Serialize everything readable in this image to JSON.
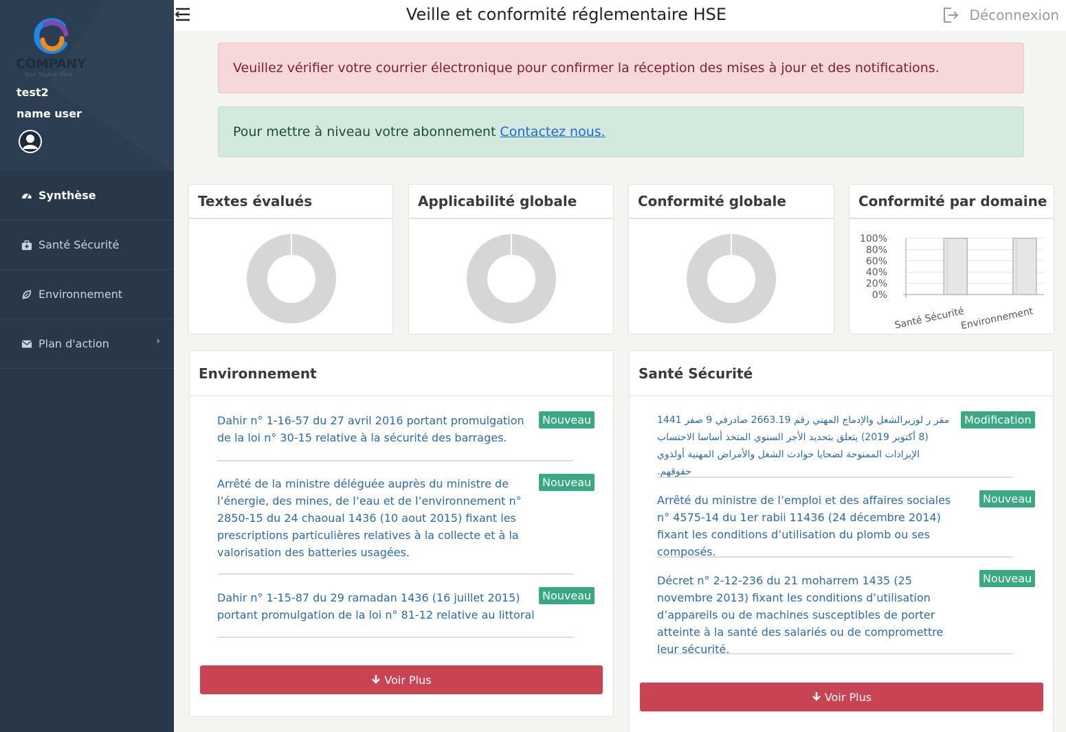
{
  "brand": {
    "name": "COMPANY",
    "tagline": "Your Tagline Here"
  },
  "user": {
    "org": "test2",
    "name": "name user"
  },
  "nav": [
    {
      "label": "Synthèse",
      "icon": "dashboard-icon",
      "active": true
    },
    {
      "label": "Santé Sécurité",
      "icon": "first-aid-icon",
      "active": false
    },
    {
      "label": "Environnement",
      "icon": "leaf-icon",
      "active": false
    },
    {
      "label": "Plan d'action",
      "icon": "envelope-icon",
      "active": false,
      "chevron": "›"
    }
  ],
  "header": {
    "title": "Veille et conformité réglementaire HSE",
    "logout": "Déconnexion"
  },
  "alerts": {
    "danger": "Veuillez vérifier votre courrier électronique pour confirmer la réception des mises à jour et des notifications.",
    "success_text": "Pour mettre à niveau votre abonnement",
    "success_link": "Contactez nous."
  },
  "cards": {
    "textes": "Textes évalués",
    "applicabilite": "Applicabilité globale",
    "conformite": "Conformité globale",
    "domaine": "Conformité par domaine"
  },
  "chart_data": {
    "type": "bar",
    "categories": [
      "Santé Sécurité",
      "Environnement"
    ],
    "values": [
      100,
      100
    ],
    "yticks": [
      "100%",
      "80%",
      "60%",
      "40%",
      "20%",
      "0%"
    ],
    "ylim": [
      0,
      100
    ],
    "grid": true,
    "bar_color": "#e6e6e6"
  },
  "environnement": {
    "title": "Environnement",
    "items": [
      {
        "text": "Dahir n° 1-16-57 du 27 avril 2016 portant promulgation de la loi n° 30-15 relative à la sécurité des barrages.",
        "badge": "Nouveau"
      },
      {
        "text": "Arrêté de la ministre déléguée auprès du ministre de l’énergie, des mines, de l’eau et de l’environnement n° 2850-15 du 24 chaoual 1436 (10 aout 2015) fixant les prescriptions particulières relatives à la collecte et à la valorisation des batteries usagées.",
        "badge": "Nouveau"
      },
      {
        "text": "Dahir n° 1-15-87 du 29 ramadan 1436 (16 juillet 2015) portant promulgation de la loi n° 81-12 relative au littoral",
        "badge": "Nouveau"
      }
    ],
    "more": "Voir Plus"
  },
  "sante": {
    "title": "Santé Sécurité",
    "items": [
      {
        "text": "مقر ر لوزيرالشغل والإدماج المهني رقم 2663.19 صادرفي 9 صفر 1441 (8 أكتوبر 2019) يتعلق بتحديد الأجر السنوي المتخذ أساسا الاحتساب الإيرادات الممنوحة لضحايا حوادث الشغل والأمراض المهنية أولذوي حقوقهم.",
        "badge": "Modification"
      },
      {
        "text": "Arrêté du ministre de l’emploi et des affaires sociales n° 4575-14 du 1er rabii 11436 (24 décembre 2014) fixant les conditions d’utilisation du plomb ou ses composés.",
        "badge": "Nouveau"
      },
      {
        "text": "Décret n° 2-12-236 du 21 moharrem 1435 (25 novembre 2013) fixant les conditions d’utilisation d’appareils ou de machines susceptibles de porter atteinte à la santé des salariés ou de compromettre leur sécurité.",
        "badge": "Nouveau"
      }
    ],
    "more": "Voir Plus"
  },
  "colors": {
    "sidebar": "#283849",
    "badge": "#3aa983",
    "button": "#c94453",
    "link": "#2c6aa5",
    "donut": "#d6d6d6"
  }
}
